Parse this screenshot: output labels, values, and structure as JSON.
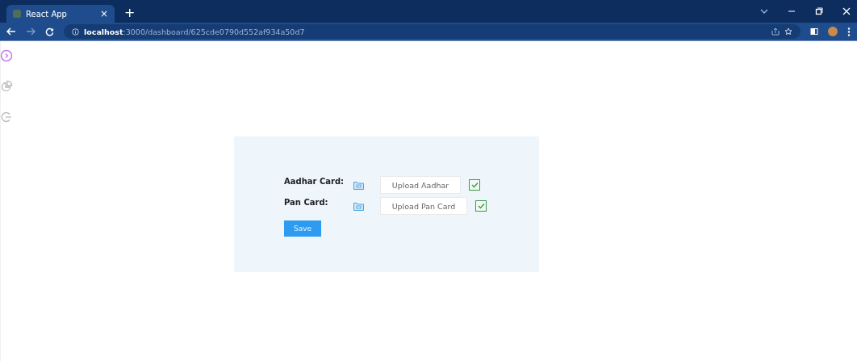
{
  "browser": {
    "tab_title": "React App",
    "tab_close": "×",
    "new_tab": "+",
    "url": "**localhost**:3000/dashboard/625cde0790d552af934a50d7"
  },
  "sidebar": {
    "items": [
      {
        "kind": "expand",
        "selected": true
      },
      {
        "kind": "chart",
        "selected": false
      },
      {
        "kind": "logout",
        "selected": false
      }
    ]
  },
  "form": {
    "rows": [
      {
        "label": "Aadhar Card:",
        "button": "Upload Aadhar",
        "checked": true
      },
      {
        "label": "Pan Card:",
        "button": "Upload Pan Card",
        "checked": true
      }
    ],
    "save": "Save"
  }
}
